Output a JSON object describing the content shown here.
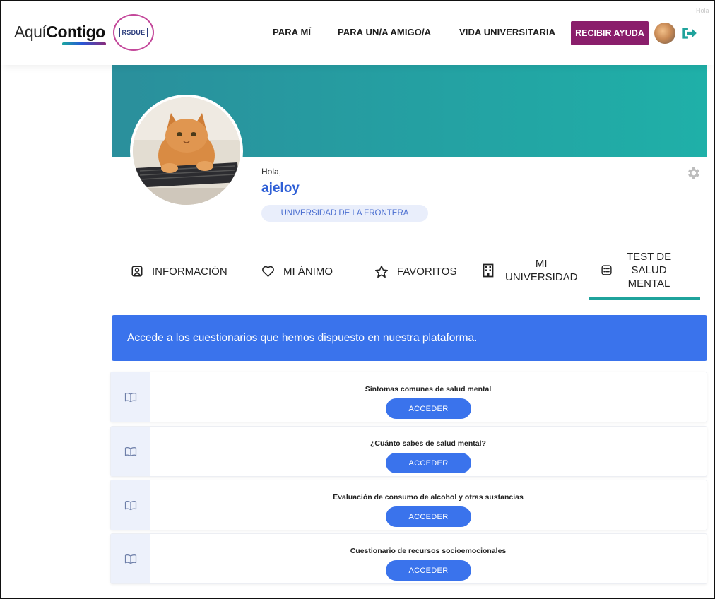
{
  "header": {
    "logo": {
      "text_light": "Aquí",
      "text_bold": "Contigo",
      "badge": "RSDUE"
    },
    "nav": [
      "PARA MÍ",
      "PARA UN/A AMIGO/A",
      "VIDA UNIVERSITARIA"
    ],
    "help_button": "RECIBIR AYUDA",
    "hint": "Hola"
  },
  "profile": {
    "greeting": "Hola,",
    "username": "ajeloy",
    "university": "UNIVERSIDAD DE LA FRONTERA"
  },
  "tabs": [
    {
      "label": "INFORMACIÓN",
      "icon": "user-badge-icon"
    },
    {
      "label": "MI ÁNIMO",
      "icon": "heart-icon"
    },
    {
      "label": "FAVORITOS",
      "icon": "star-icon"
    },
    {
      "label_line1": "MI",
      "label_line2": "UNIVERSIDAD",
      "icon": "building-icon"
    },
    {
      "label_line1": "TEST DE",
      "label_line2": "SALUD",
      "label_line3": "MENTAL",
      "icon": "checklist-icon",
      "active": true
    }
  ],
  "info_banner": "Accede a los cuestionarios que hemos dispuesto en nuestra plataforma.",
  "questionnaires": [
    {
      "title": "Síntomas comunes de salud mental",
      "button": "ACCEDER"
    },
    {
      "title": "¿Cuánto sabes de salud mental?",
      "button": "ACCEDER"
    },
    {
      "title": "Evaluación de consumo de alcohol y otras sustancias",
      "button": "ACCEDER"
    },
    {
      "title": "Cuestionario de recursos socioemocionales",
      "button": "ACCEDER"
    }
  ],
  "colors": {
    "accent_blue": "#3a73ec",
    "help_purple": "#8a1e6b",
    "banner_teal": "#1fb0a8",
    "active_tab_underline": "#1fa39c"
  }
}
